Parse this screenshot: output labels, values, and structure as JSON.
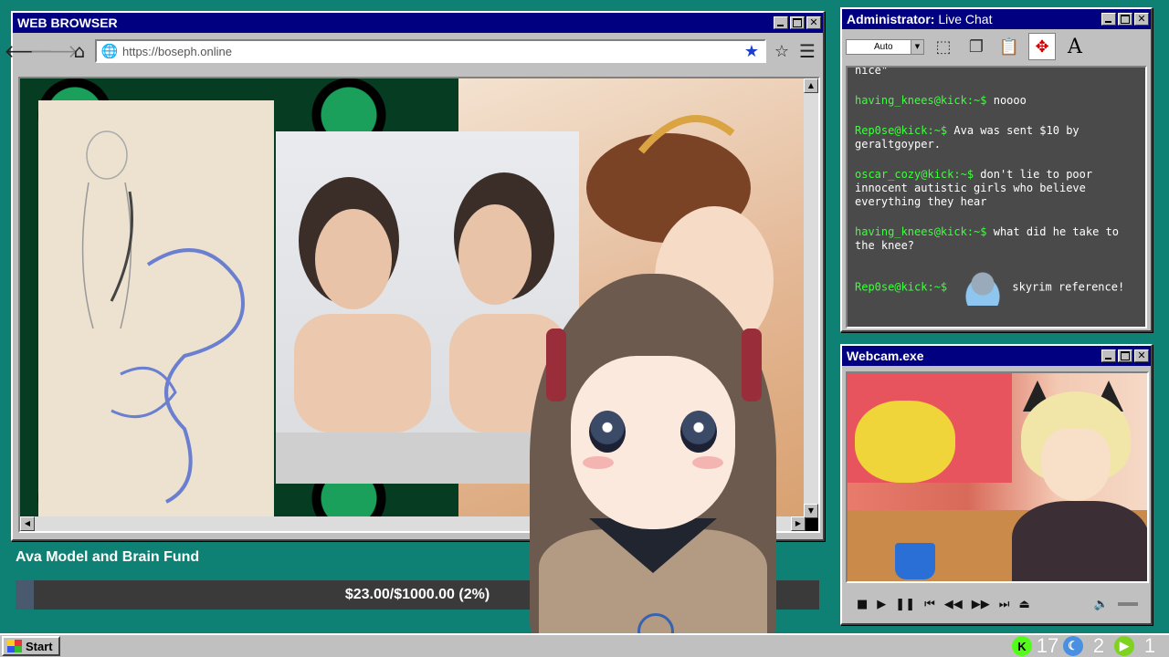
{
  "browser": {
    "title": "WEB BROWSER",
    "url": "https://boseph.online"
  },
  "fund": {
    "title": "Ava Model and Brain Fund",
    "progress_text": "$23.00/$1000.00 (2%)",
    "progress_fraction": 0.023
  },
  "chat": {
    "title_bold": "Administrator:",
    "title_rest": " Live Chat",
    "font_size_select": "Auto",
    "messages": [
      {
        "user": "",
        "text": "nice\""
      },
      {
        "user": "having_knees@kick:~$",
        "text": "noooo"
      },
      {
        "user": "Rep0se@kick:~$",
        "text": "Ava was sent $10 by geraltgoyper."
      },
      {
        "user": "oscar_cozy@kick:~$",
        "text": "don't lie to poor innocent autistic girls who believe everything they hear"
      },
      {
        "user": "having_knees@kick:~$",
        "text": "what did he take to the knee?"
      },
      {
        "user": "Rep0se@kick:~$",
        "text": "skyrim reference!"
      }
    ]
  },
  "webcam": {
    "title": "Webcam.exe"
  },
  "taskbar": {
    "start_label": "Start",
    "tray": [
      {
        "icon": "kick-icon",
        "count": "17",
        "color": "#53fc18"
      },
      {
        "icon": "moon-icon",
        "count": "2",
        "color": "#4a90e2"
      },
      {
        "icon": "play-icon",
        "count": "1",
        "color": "#7ed321"
      }
    ]
  },
  "colors": {
    "desktop": "#0f8074",
    "titlebar": "#000080",
    "chat_user": "#3cff3c"
  }
}
